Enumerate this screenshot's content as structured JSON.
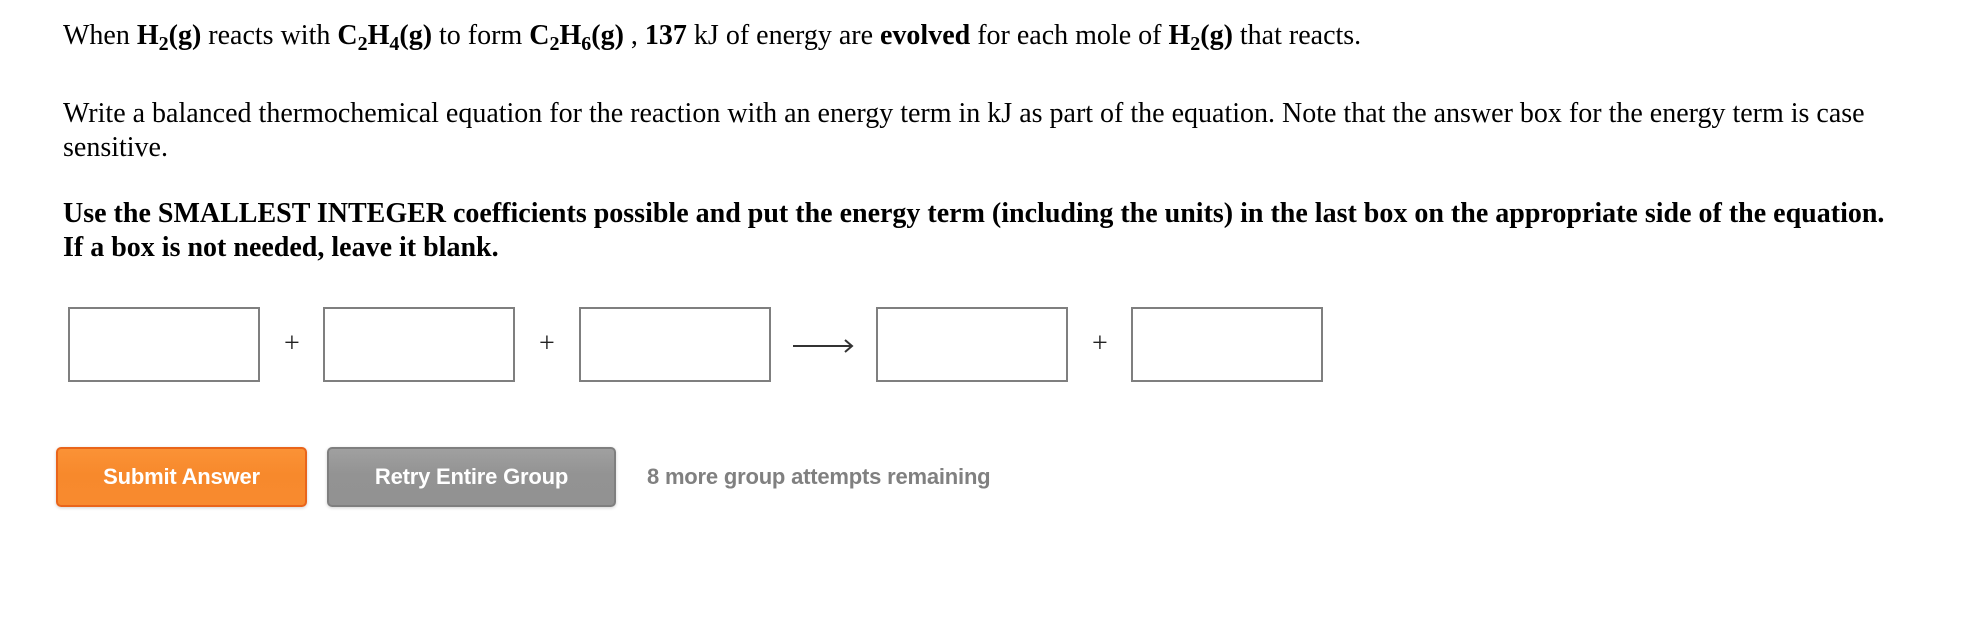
{
  "question": {
    "intro": {
      "when": "When ",
      "reactant1": {
        "symbol": "H",
        "sub": "2",
        "state": "(g)"
      },
      "reacts_with": " reacts with ",
      "reactant2": {
        "symbol1": "C",
        "sub1": "2",
        "symbol2": "H",
        "sub2": "4",
        "state": "(g)"
      },
      "to_form": " to form ",
      "product": {
        "symbol1": "C",
        "sub1": "2",
        "symbol2": "H",
        "sub2": "6",
        "state": "(g)"
      },
      "comma": " , ",
      "energy_value": "137",
      "energy_text": " kJ of energy are ",
      "direction": "evolved",
      "per_mole": " for each mole of ",
      "per_species": {
        "symbol": "H",
        "sub": "2",
        "state": "(g)"
      },
      "end": " that reacts."
    },
    "instruction": "Write a balanced thermochemical equation for the reaction with an energy term in kJ as part of the equation. Note that the answer box for the energy term is case sensitive.",
    "emphasis": "Use the SMALLEST INTEGER coefficients possible and put the energy term (including the units) in the last box on the appropriate side of the equation. If a box is not needed, leave it blank."
  },
  "equation": {
    "boxes": [
      "",
      "",
      "",
      "",
      ""
    ],
    "operators": [
      "+",
      "+",
      "+"
    ],
    "arrow": "reaction-arrow"
  },
  "actions": {
    "submit_label": "Submit Answer",
    "retry_label": "Retry Entire Group",
    "attempts_text": "8 more group attempts remaining"
  },
  "colors": {
    "submit": "#F88A2F",
    "retry": "#939393",
    "attempts": "#808080",
    "box_border": "#7F7F7F"
  }
}
